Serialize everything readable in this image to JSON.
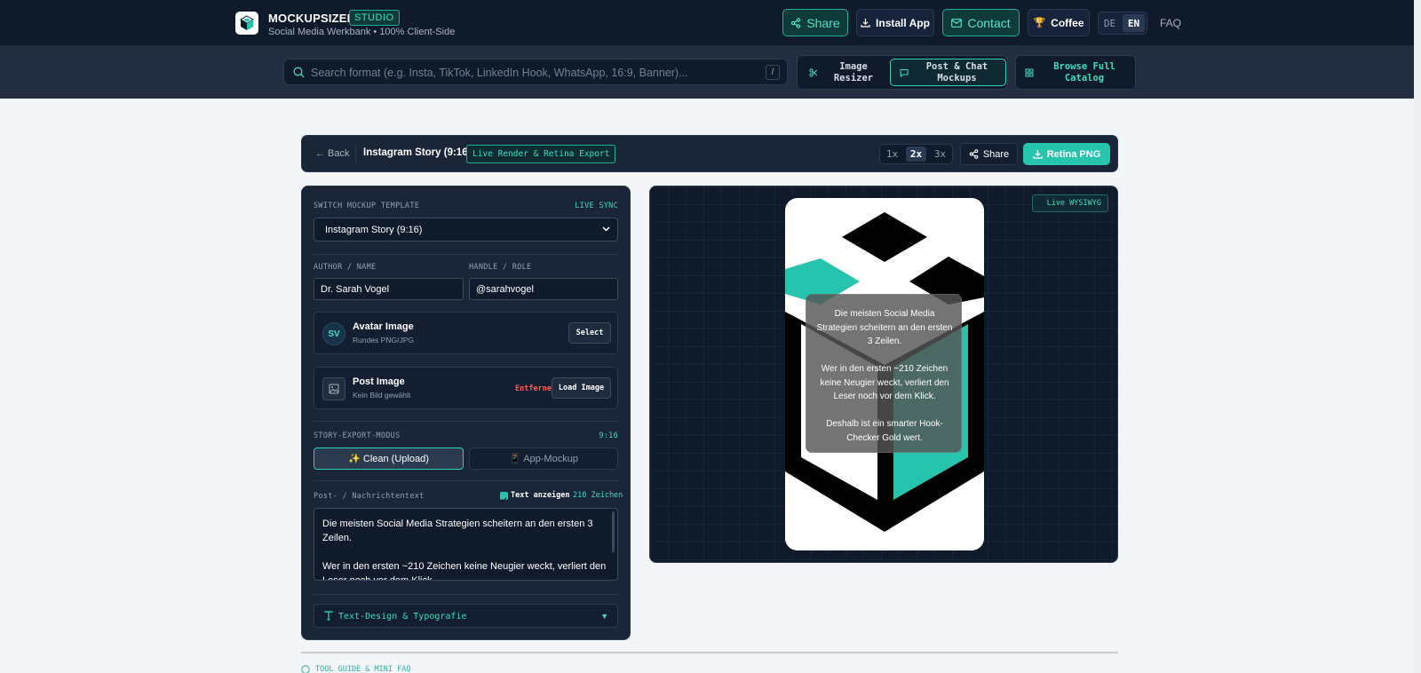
{
  "header": {
    "brand": "MOCKUPSIZER",
    "studio_badge": "STUDIO",
    "tagline": "Social Media Werkbank • 100% Client-Side",
    "share_label": "Share",
    "install_label": "Install App",
    "contact_label": "Contact",
    "coffee_label": "Coffee",
    "lang_de": "DE",
    "lang_en": "EN",
    "faq_label": "FAQ"
  },
  "toolbar": {
    "search_placeholder": "Search format (e.g. Insta, TikTok, LinkedIn Hook, WhatsApp, 16:9, Banner)...",
    "search_shortcut": "/",
    "image_resizer_line1": "Image",
    "image_resizer_line2": "Resizer",
    "mockups_line1": "Post & Chat",
    "mockups_line2": "Mockups",
    "catalog_line1": "Browse Full",
    "catalog_line2": "Catalog"
  },
  "editor_bar": {
    "back_label": "← Back",
    "title": "Instagram Story (9:16)",
    "badge": "Live Render & Retina Export",
    "scale_1x": "1x",
    "scale_2x": "2x",
    "scale_3x": "3x",
    "share_label": "Share",
    "export_label": "Retina PNG"
  },
  "panel": {
    "template_label": "SWITCH MOCKUP TEMPLATE",
    "live_sync": "LIVE SYNC",
    "template_value": "Instagram Story (9:16)",
    "author_label": "AUTHOR / NAME",
    "handle_label": "HANDLE / ROLE",
    "author_value": "Dr. Sarah Vogel",
    "handle_value": "@sarahvogel",
    "avatar_initials": "SV",
    "avatar_title": "Avatar Image",
    "avatar_sub": "Rundes PNG/JPG",
    "avatar_select": "Select",
    "post_title": "Post Image",
    "post_sub": "Kein Bild gewählt",
    "post_remove": "Entfernen",
    "post_load": "Load Image",
    "export_mode_label": "STORY-EXPORT-MODUS",
    "export_ratio": "9:16",
    "mode_clean": "✨ Clean (Upload)",
    "mode_app": "📱 App-Mockup",
    "text_label": "Post- / Nachrichtentext",
    "show_text_label": "Text anzeigen",
    "char_count": "210 Zeichen",
    "text_value": "Die meisten Social Media Strategien scheitern an den ersten 3 Zeilen.\n\nWer in den ersten ~210 Zeichen keine Neugier weckt, verliert den Leser noch vor dem Klick.",
    "typography_label": "Text-Design & Typografie"
  },
  "preview": {
    "badge": "Live WYSIWYG",
    "overlay_text": "Die meisten Social Media Strategien scheitern an den ersten 3 Zeilen.\n\nWer in den ersten ~210 Zeichen keine Neugier weckt, verliert den Leser noch vor dem Klick.\n\nDeshalb ist ein smarter Hook-Checker Gold wert."
  },
  "footer": {
    "guide_label": "TOOL GUIDE & MINI FAQ"
  },
  "colors": {
    "accent": "#27c4ad",
    "header_bg": "#0f1a2b",
    "panel_bg": "#1a2538",
    "danger": "#ff5a5a"
  }
}
